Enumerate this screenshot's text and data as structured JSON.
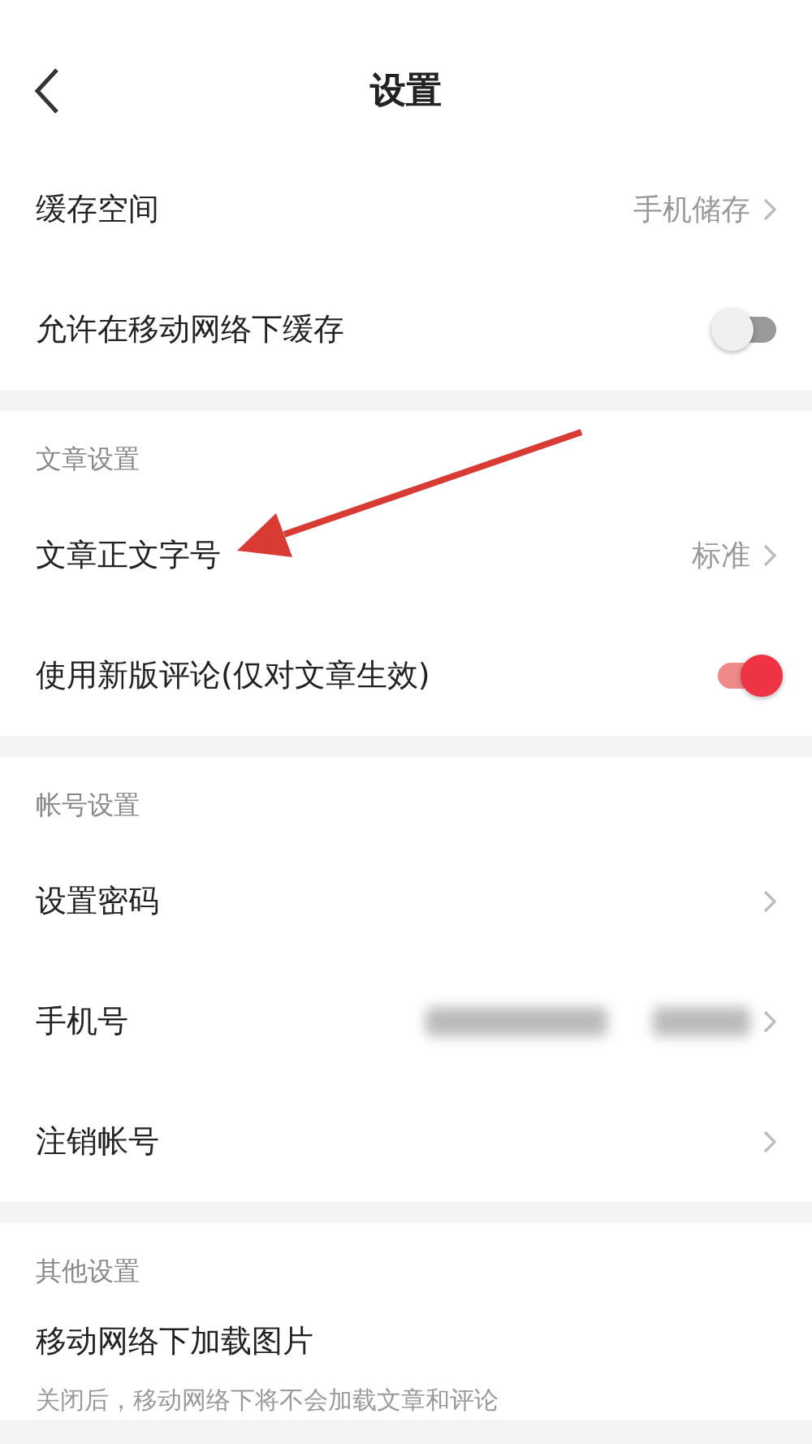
{
  "header": {
    "title": "设置"
  },
  "groups": [
    {
      "rows": [
        {
          "kind": "link",
          "label": "缓存空间",
          "value": "手机储存"
        },
        {
          "kind": "toggle",
          "label": "允许在移动网络下缓存",
          "on": false
        }
      ]
    },
    {
      "title": "文章设置",
      "rows": [
        {
          "kind": "link",
          "label": "文章正文字号",
          "value": "标准"
        },
        {
          "kind": "toggle",
          "label": "使用新版评论(仅对文章生效)",
          "on": true
        }
      ]
    },
    {
      "title": "帐号设置",
      "rows": [
        {
          "kind": "link",
          "label": "设置密码"
        },
        {
          "kind": "link",
          "label": "手机号",
          "redacted": true
        },
        {
          "kind": "link",
          "label": "注销帐号"
        }
      ]
    },
    {
      "title": "其他设置",
      "rows": [
        {
          "kind": "text",
          "label": "移动网络下加载图片",
          "description": "关闭后，移动网络下将不会加载文章和评论"
        }
      ]
    }
  ],
  "annotation": {
    "kind": "arrow"
  }
}
